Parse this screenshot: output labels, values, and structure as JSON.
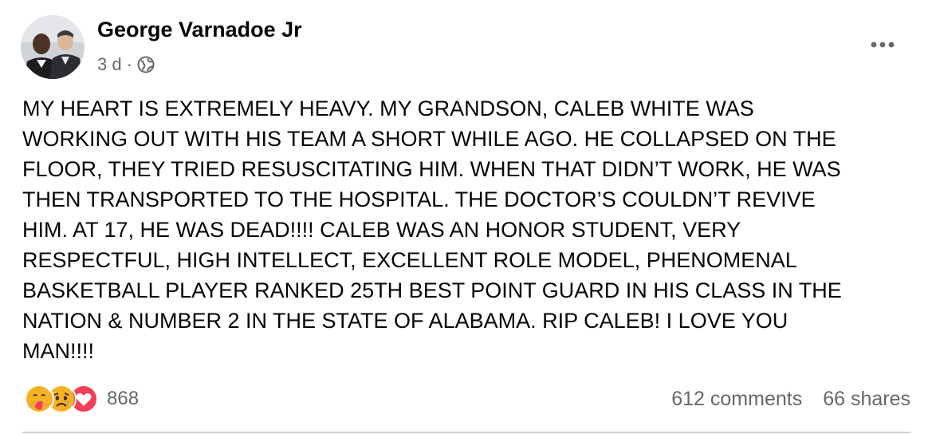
{
  "post": {
    "author": "George Varnadoe Jr",
    "timestamp": "3 d",
    "separator": "·",
    "audience_icon": "globe-icon",
    "more_icon": "more-options-icon",
    "text": "MY HEART IS EXTREMELY HEAVY.  MY GRANDSON, CALEB WHITE WAS\nWORKING OUT WITH HIS TEAM A SHORT WHILE AGO.  HE COLLAPSED ON THE\nFLOOR, THEY TRIED RESUSCITATING HIM.  WHEN THAT DIDN’T WORK, HE WAS\nTHEN TRANSPORTED TO THE HOSPITAL. THE DOCTOR’S COULDN’T REVIVE\nHIM.  AT 17, HE WAS DEAD!!!!  CALEB WAS AN HONOR STUDENT, VERY\nRESPECTFUL, HIGH INTELLECT, EXCELLENT ROLE MODEL, PHENOMENAL\nBASKETBALL PLAYER RANKED 25TH BEST POINT GUARD IN HIS CLASS IN THE\nNATION & NUMBER 2 IN THE STATE OF ALABAMA.  RIP CALEB!  I LOVE YOU\nMAN!!!!"
  },
  "reactions": {
    "icons": [
      "care-reaction-icon",
      "sad-reaction-icon",
      "love-reaction-icon"
    ],
    "count": "868"
  },
  "stats": {
    "comments": "612 comments",
    "shares": "66 shares"
  },
  "colors": {
    "text": "#050505",
    "secondary_text": "#65676b",
    "divider": "#ced0d4",
    "love_red": "#f33e58",
    "emoji_yellow": "#f7b125"
  }
}
